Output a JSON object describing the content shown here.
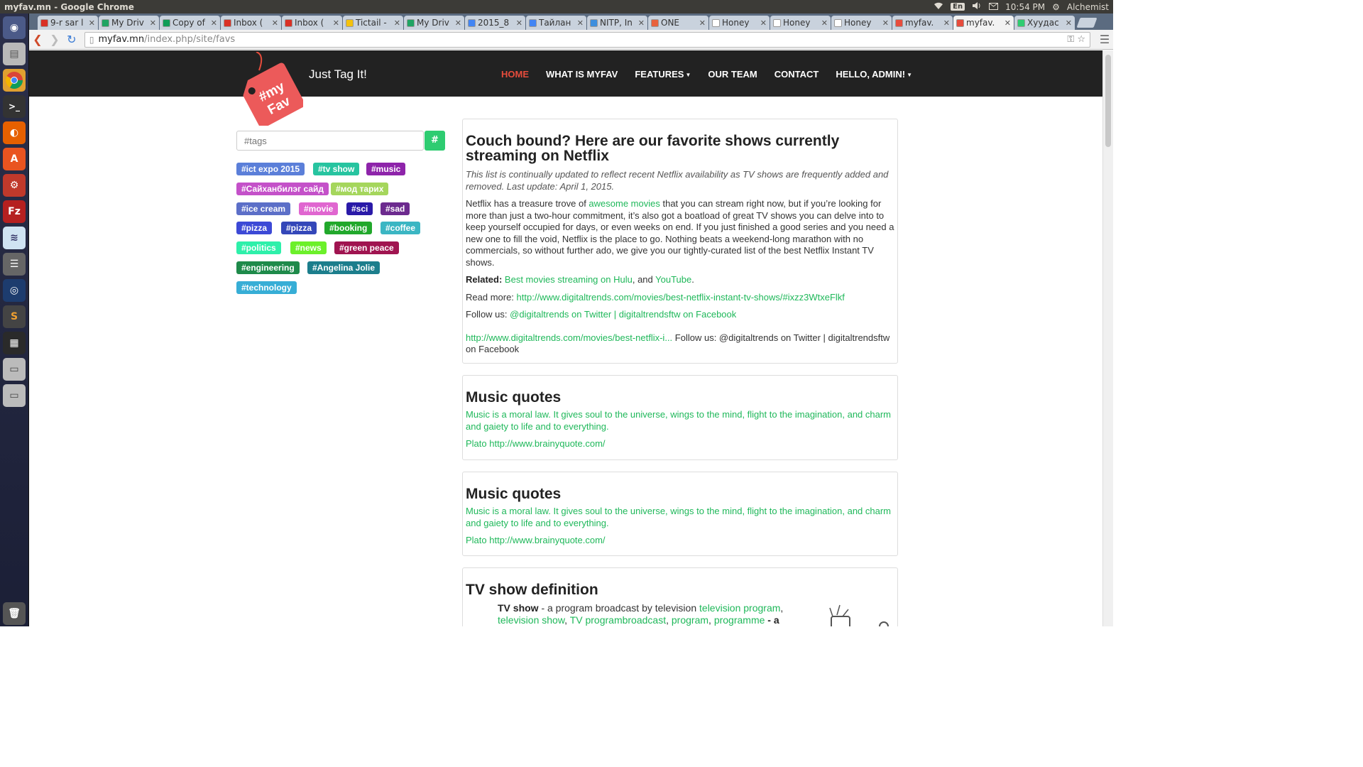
{
  "window": {
    "title": "myfav.mn - Google Chrome",
    "keyboard": "En",
    "time": "10:54 PM",
    "user": "Alchemist"
  },
  "tabs": [
    {
      "label": "9-r sar l",
      "icon": "gmail-icon",
      "color": "#d93025"
    },
    {
      "label": "My Driv",
      "icon": "drive-icon",
      "color": "#1fa463"
    },
    {
      "label": "Copy of",
      "icon": "sheets-icon",
      "color": "#0f9d58"
    },
    {
      "label": "Inbox (",
      "icon": "gmail-icon",
      "color": "#d93025"
    },
    {
      "label": "Inbox (",
      "icon": "gmail-icon",
      "color": "#d93025"
    },
    {
      "label": "Tictail -",
      "icon": "tictail-icon",
      "color": "#f4c20d"
    },
    {
      "label": "My Driv",
      "icon": "drive-icon",
      "color": "#1fa463"
    },
    {
      "label": "2015_8",
      "icon": "docs-icon",
      "color": "#4285f4"
    },
    {
      "label": "Тайлан",
      "icon": "docs-icon",
      "color": "#4285f4"
    },
    {
      "label": "NITP, In",
      "icon": "globe-icon",
      "color": "#3b8ede"
    },
    {
      "label": "ONE",
      "icon": "one-icon",
      "color": "#e8613c"
    },
    {
      "label": "Honey",
      "icon": "page-icon",
      "color": "#ffffff"
    },
    {
      "label": "Honey",
      "icon": "page-icon",
      "color": "#ffffff"
    },
    {
      "label": "Honey",
      "icon": "page-icon",
      "color": "#ffffff"
    },
    {
      "label": "myfav.",
      "icon": "myfav-icon",
      "color": "#e74c3c"
    },
    {
      "label": "myfav.",
      "icon": "myfav-icon",
      "color": "#e74c3c",
      "active": true
    },
    {
      "label": "Хуудас",
      "icon": "puzzle-icon",
      "color": "#2ecc71"
    }
  ],
  "address": {
    "host": "myfav.mn",
    "path": "/index.php/site/favs"
  },
  "site": {
    "logo_text": "#myFav",
    "tagline": "Just Tag It!",
    "menu": [
      "HOME",
      "WHAT IS MYFAV",
      "FEATURES",
      "OUR TEAM",
      "CONTACT",
      "HELLO, ADMIN!"
    ]
  },
  "search": {
    "placeholder": "#tags",
    "button": "#"
  },
  "tags": [
    {
      "label": "#ict expo 2015",
      "color": "#5b7fd9"
    },
    {
      "label": "#tv show",
      "color": "#27c4a0"
    },
    {
      "label": "#music",
      "color": "#8e24aa"
    },
    {
      "label": "#Сайханбилэг сайд",
      "color": "#c451c9"
    },
    {
      "label": "#мод тарих",
      "color": "#a5d65c"
    },
    {
      "label": "#ice cream",
      "color": "#5c6fc8"
    },
    {
      "label": "#movie",
      "color": "#e066d0"
    },
    {
      "label": "#sci",
      "color": "#2a1aa8"
    },
    {
      "label": "#sad",
      "color": "#6c2a8e"
    },
    {
      "label": "#pizza",
      "color": "#3c49d6"
    },
    {
      "label": "#pizza",
      "color": "#3447b9"
    },
    {
      "label": "#booking",
      "color": "#21a82b"
    },
    {
      "label": "#coffee",
      "color": "#3bb6c3"
    },
    {
      "label": "#politics",
      "color": "#2ef0aa"
    },
    {
      "label": "#news",
      "color": "#6cf02a"
    },
    {
      "label": "#green peace",
      "color": "#a01450"
    },
    {
      "label": "#engineering",
      "color": "#1e8a4a"
    },
    {
      "label": "#Angelina Jolie",
      "color": "#1c7e8c"
    },
    {
      "label": "#technology",
      "color": "#37aed6"
    }
  ],
  "cards": [
    {
      "title": "Couch bound? Here are our favorite shows currently streaming on Netflix",
      "note": "This list is continually updated to reflect recent Netflix availability as TV shows are frequently added and removed. Last update: April 1, 2015.",
      "body_before": "Netflix has a treasure trove of ",
      "body_link": "awesome movies",
      "body_after": " that you can stream right now, but if you’re looking for more than just a two-hour commitment, it’s also got a boatload of great TV shows you can delve into to keep yourself occupied for days, or even weeks on end. If you just finished a good series and you need a new one to fill the void, Netflix is the place to go. Nothing beats a weekend-long marathon with no commercials, so without further ado, we give you our tightly-curated list of the best Netflix Instant TV shows.",
      "related_label": "Related:",
      "related_link1": "Best movies streaming on Hulu",
      "related_mid": ", and ",
      "related_link2": "YouTube",
      "related_end": ".",
      "readmore_label": "Read more: ",
      "readmore_link": "http://www.digitaltrends.com/movies/best-netflix-instant-tv-shows/#ixzz3WtxeFlkf",
      "follow_label": "Follow us: ",
      "follow_link1": "@digitaltrends on Twitter",
      "follow_sep": " | ",
      "follow_link2": "digitaltrendsftw on Facebook",
      "footer_link": "http://www.digitaltrends.com/movies/best-netflix-i...",
      "footer_text": " Follow us: @digitaltrends on Twitter | digitaltrendsftw on Facebook"
    },
    {
      "title": "Music quotes",
      "quote": "Music is a moral law. It gives soul to the universe, wings to the mind, flight to the imagination, and charm and gaiety to life and to everything.",
      "source": "Plato  http://www.brainyquote.com/"
    },
    {
      "title": "Music quotes",
      "quote": "Music is a moral law. It gives soul to the universe, wings to the mind, flight to the imagination, and charm and gaiety to life and to everything.",
      "source": "Plato  http://www.brainyquote.com/"
    },
    {
      "title": "TV show definition",
      "term": "TV show",
      "def_text": " - a program broadcast by television ",
      "link1": "television program",
      "comma1": ",",
      "link2": "television show",
      "comma2": ", ",
      "link3": "TV programbroadcast",
      "comma3": ", ",
      "link4": "program",
      "comma4": ", ",
      "link5": "programme",
      "tail": " - a"
    }
  ]
}
